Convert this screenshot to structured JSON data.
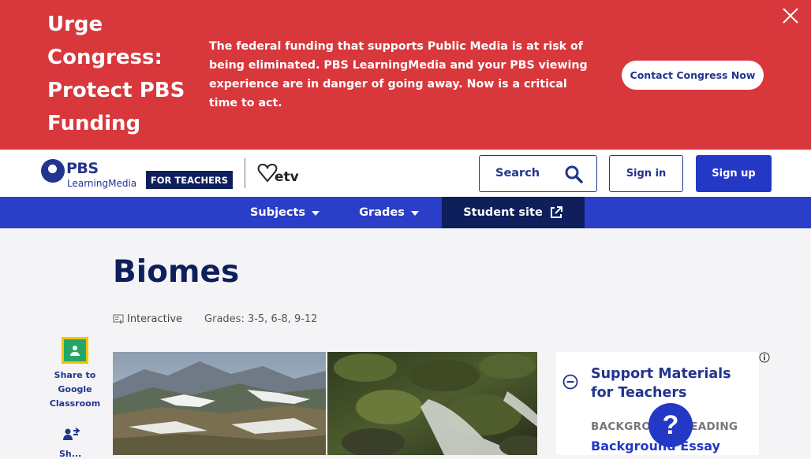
{
  "banner": {
    "title": "Urge Congress: Protect PBS Funding",
    "message": "The federal funding that supports Public Media is at risk of being eliminated. PBS LearningMedia and your PBS viewing experience are in danger of going away. Now is a critical time to act.",
    "cta_label": "Contact Congress Now",
    "bg_color": "#d8373c"
  },
  "header": {
    "logo_primary": "PBS",
    "logo_secondary": "LearningMedia",
    "audience_badge": "FOR TEACHERS",
    "partner_logo": "etv",
    "search_label": "Search",
    "signin_label": "Sign in",
    "signup_label": "Sign up"
  },
  "nav": {
    "items": [
      {
        "label": "Subjects",
        "icon": "caret-down-icon"
      },
      {
        "label": "Grades",
        "icon": "caret-down-icon"
      },
      {
        "label": "Student site",
        "icon": "external-link-icon"
      }
    ]
  },
  "resource": {
    "title": "Biomes",
    "media_type": "Interactive",
    "grades": "Grades: 3-5, 6-8, 9-12"
  },
  "share": {
    "google_classroom_label": "Share to Google Classroom",
    "second_label": "Sh..."
  },
  "support": {
    "title": "Support Materials for Teachers",
    "section_heading": "BACKGROUND READING",
    "link_label": "Background Essay"
  },
  "help": {
    "label": "?"
  },
  "colors": {
    "brand_dark": "#0e1f5c",
    "brand": "#22348f",
    "accent": "#2438c6"
  }
}
